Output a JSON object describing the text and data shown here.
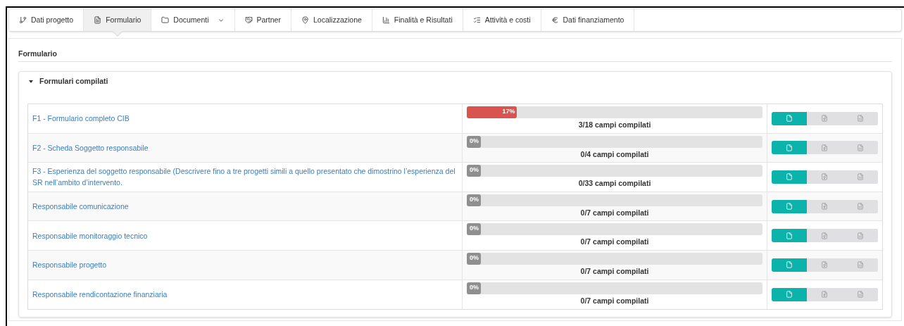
{
  "tabs": [
    {
      "label": "Dati progetto",
      "kind": "branch",
      "selected": false,
      "dropdown": false
    },
    {
      "label": "Formulario",
      "kind": "form",
      "selected": true,
      "dropdown": false
    },
    {
      "label": "Documenti",
      "kind": "folder",
      "selected": false,
      "dropdown": true
    },
    {
      "label": "Partner",
      "kind": "handshake",
      "selected": false,
      "dropdown": false
    },
    {
      "label": "Localizzazione",
      "kind": "pin",
      "selected": false,
      "dropdown": false
    },
    {
      "label": "Finalità e Risultati",
      "kind": "chart",
      "selected": false,
      "dropdown": false
    },
    {
      "label": "Attività e costi",
      "kind": "list",
      "selected": false,
      "dropdown": false
    },
    {
      "label": "Dati finanziamento",
      "kind": "euro",
      "selected": false,
      "dropdown": false
    }
  ],
  "page_title": "Formulario",
  "section": {
    "title": "Formulari compilati",
    "expanded": true,
    "rows": [
      {
        "name": "F1 - Formulario completo CIB",
        "level": 0.17,
        "percent": "17%",
        "fields": "3/18 campi compilati",
        "actions": [
          {
            "kind": "document",
            "active": true
          },
          {
            "kind": "pdf",
            "active": false
          },
          {
            "kind": "word",
            "active": false
          }
        ]
      },
      {
        "name": "F2 - Scheda Soggetto responsabile",
        "level": 0,
        "percent": "0%",
        "fields": "0/4 campi compilati",
        "actions": [
          {
            "kind": "document",
            "active": true
          },
          {
            "kind": "pdf",
            "active": false
          },
          {
            "kind": "word",
            "active": false
          }
        ]
      },
      {
        "name": "F3 - Esperienza del soggetto responsabile (Descrivere fino a tre progetti simili a quello presentato che dimostrino l’esperienza del SR nell’ambito d’intervento.",
        "level": 0,
        "percent": "0%",
        "fields": "0/33 campi compilati",
        "actions": [
          {
            "kind": "document",
            "active": true
          },
          {
            "kind": "pdf",
            "active": false
          },
          {
            "kind": "word",
            "active": false
          }
        ]
      },
      {
        "name": "Responsabile comunicazione",
        "level": 0,
        "percent": "0%",
        "fields": "0/7 campi compilati",
        "actions": [
          {
            "kind": "document",
            "active": true
          },
          {
            "kind": "pdf",
            "active": false
          },
          {
            "kind": "word",
            "active": false
          }
        ]
      },
      {
        "name": "Responsabile monitoraggio tecnico",
        "level": 0,
        "percent": "0%",
        "fields": "0/7 campi compilati",
        "actions": [
          {
            "kind": "document",
            "active": true
          },
          {
            "kind": "pdf",
            "active": false
          },
          {
            "kind": "word",
            "active": false
          }
        ]
      },
      {
        "name": "Responsabile progetto",
        "level": 0,
        "percent": "0%",
        "fields": "0/7 campi compilati",
        "actions": [
          {
            "kind": "document",
            "active": true
          },
          {
            "kind": "pdf",
            "active": false
          },
          {
            "kind": "word",
            "active": false
          }
        ]
      },
      {
        "name": "Responsabile rendicontazione finanziaria",
        "level": 0,
        "percent": "0%",
        "fields": "0/7 campi compilati",
        "actions": [
          {
            "kind": "document",
            "active": true
          },
          {
            "kind": "pdf",
            "active": false
          },
          {
            "kind": "word",
            "active": false
          }
        ]
      }
    ]
  }
}
